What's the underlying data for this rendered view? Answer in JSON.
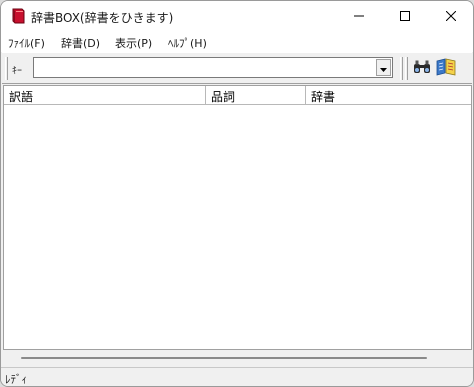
{
  "window": {
    "title": "辞書BOX(辞書をひきます)",
    "app_icon": "red-book-icon",
    "controls": [
      "minimize-icon",
      "maximize-icon",
      "close-icon"
    ]
  },
  "menu": {
    "file": "ﾌｧｲﾙ(F)",
    "dictionary": "辞書(D)",
    "view": "表示(P)",
    "help": "ﾍﾙﾌﾟ(H)"
  },
  "toolbar": {
    "key_label": "ｷｰ",
    "key_input": {
      "value": "",
      "placeholder": ""
    },
    "search_icon": "binoculars-icon",
    "dictionary_icon": "open-book-icon"
  },
  "list": {
    "columns": [
      "訳語",
      "品詞",
      "辞書"
    ],
    "rows": []
  },
  "status": {
    "text": "ﾚﾃﾞｨ"
  }
}
